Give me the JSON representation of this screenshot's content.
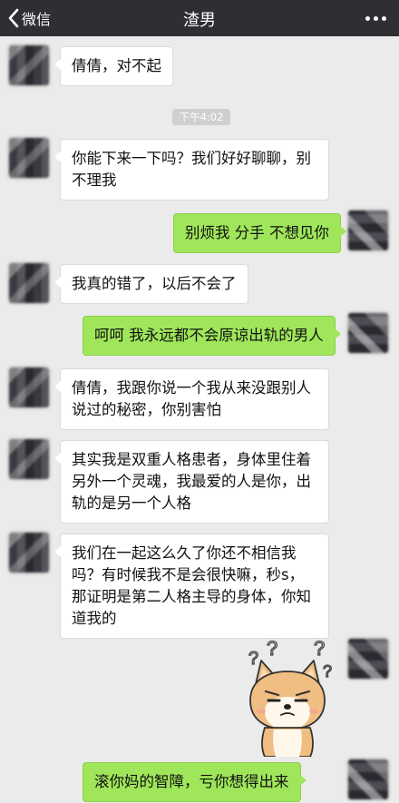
{
  "header": {
    "back_label": "微信",
    "title": "渣男",
    "icons": {
      "back": "chevron-left-icon",
      "more": "more-dots-icon"
    }
  },
  "timestamp": "下午4:02",
  "messages": [
    {
      "side": "left",
      "text": "倩倩，对不起"
    },
    {
      "side": "left",
      "text": "你能下来一下吗？我们好好聊聊，别\n不理我"
    },
    {
      "side": "right",
      "text": "别烦我 分手 不想见你"
    },
    {
      "side": "left",
      "text": "我真的错了，以后不会了"
    },
    {
      "side": "right",
      "text": "呵呵 我永远都不会原谅出轨的男人"
    },
    {
      "side": "left",
      "text": "倩倩，我跟你说一个我从来没跟别人\n说过的秘密，你别害怕"
    },
    {
      "side": "left",
      "text": "其实我是双重人格患者，身体里住着\n另外一个灵魂，我最爱的人是你，出\n轨的是另一个人格"
    },
    {
      "side": "left",
      "text": "我们在一起这么久了你还不相信我\n吗？有时候我不是会很快嘛，秒s，\n那证明是第二人格主导的身体，你知\n道我的"
    },
    {
      "side": "right",
      "text": "",
      "sticker": "confused-shiba-dog-sticker"
    },
    {
      "side": "right",
      "text": "滚你妈的智障，亏你想得出来"
    }
  ],
  "colors": {
    "header_bg": "#2e2e33",
    "chat_bg": "#ebebeb",
    "bubble_sent": "#9fe65a",
    "bubble_received": "#ffffff"
  }
}
